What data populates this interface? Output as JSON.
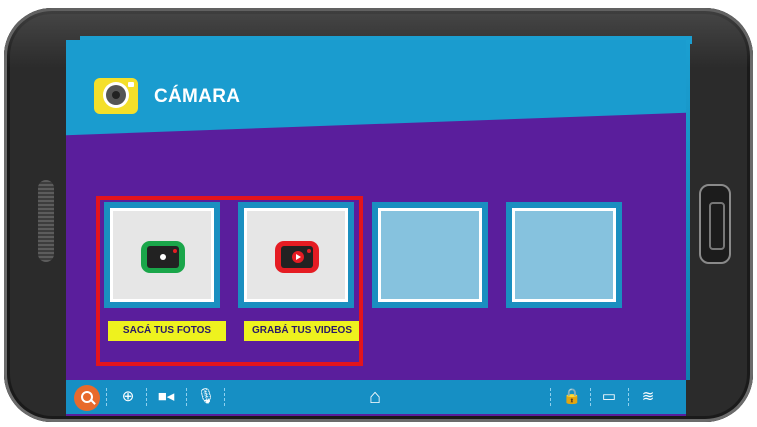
{
  "app": {
    "title": "CÁMARA",
    "icon": "camera-icon"
  },
  "tiles": [
    {
      "label": "SACÁ TUS FOTOS",
      "icon": "photo-camera-icon",
      "color": "#1aa64a"
    },
    {
      "label": "GRABÁ TUS VIDEOS",
      "icon": "video-camera-icon",
      "color": "#e51c23"
    },
    {
      "label": "",
      "icon": ""
    },
    {
      "label": "",
      "icon": ""
    }
  ],
  "bottom_bar": {
    "left_icons": [
      "search-icon",
      "globe-icon",
      "video-icon",
      "microphone-icon"
    ],
    "center_icon": "home-icon",
    "right_icons": [
      "lock-icon",
      "battery-icon",
      "wifi-icon"
    ]
  },
  "colors": {
    "header": "#1a9ccf",
    "background": "#5a1e9c",
    "label": "#eef21e",
    "highlight": "#e3141c"
  }
}
